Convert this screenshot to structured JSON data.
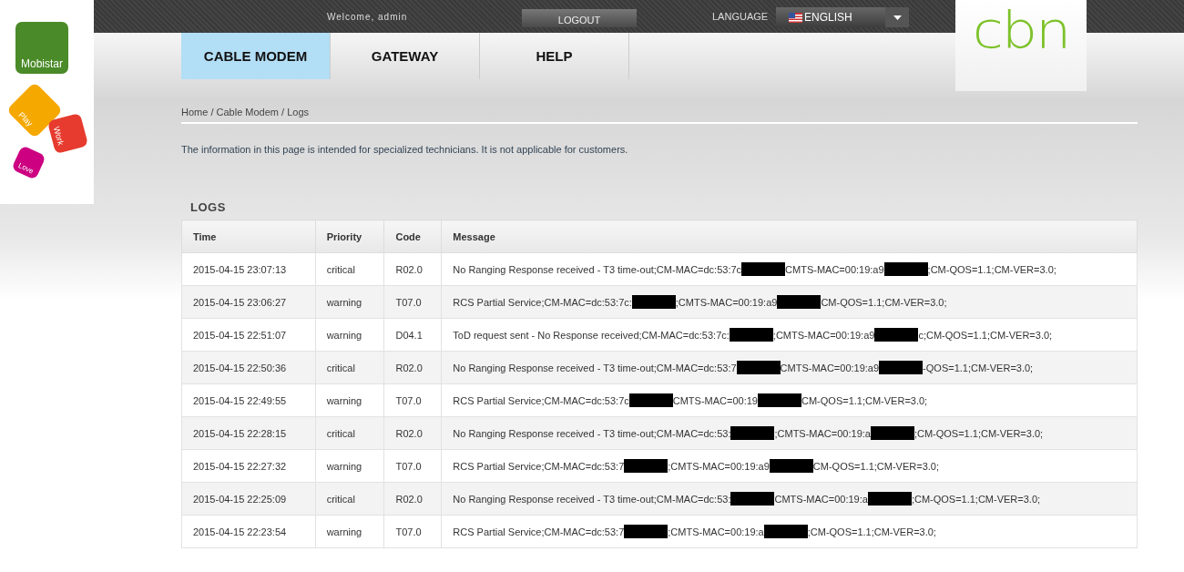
{
  "brand": {
    "name": "Mobistar",
    "tiles": [
      "Play",
      "Work",
      "Love"
    ],
    "logo": "cbn"
  },
  "top_bar": {
    "welcome": "Welcome, admin",
    "logout": "LOGOUT",
    "language_label": "LANGUAGE",
    "language": "ENGLISH"
  },
  "tabs": [
    {
      "label": "CABLE MODEM",
      "selected": true
    },
    {
      "label": "GATEWAY",
      "selected": false
    },
    {
      "label": "HELP",
      "selected": false
    }
  ],
  "breadcrumb": "Home / Cable Modem / Logs",
  "notice": "The information in this page is intended for specialized technicians. It is not applicable for customers.",
  "logs": {
    "title": "LOGS",
    "columns": [
      "Time",
      "Priority",
      "Code",
      "Message"
    ],
    "rows": [
      {
        "time": "2015-04-15 23:07:13",
        "priority": "critical",
        "code": "R02.0",
        "message": [
          {
            "kind": "text",
            "text": "No Ranging Response received - T3 time-out;CM-MAC=dc:53:7c"
          },
          {
            "kind": "redacted"
          },
          {
            "kind": "text",
            "text": "CMTS-MAC=00:19:a9"
          },
          {
            "kind": "redacted"
          },
          {
            "kind": "text",
            "text": ";CM-QOS=1.1;CM-VER=3.0;"
          }
        ]
      },
      {
        "time": "2015-04-15 23:06:27",
        "priority": "warning",
        "code": "T07.0",
        "message": [
          {
            "kind": "text",
            "text": "RCS Partial Service;CM-MAC=dc:53:7c:"
          },
          {
            "kind": "redacted"
          },
          {
            "kind": "text",
            "text": ";CMTS-MAC=00:19:a9"
          },
          {
            "kind": "redacted"
          },
          {
            "kind": "text",
            "text": "CM-QOS=1.1;CM-VER=3.0;"
          }
        ]
      },
      {
        "time": "2015-04-15 22:51:07",
        "priority": "warning",
        "code": "D04.1",
        "message": [
          {
            "kind": "text",
            "text": "ToD request sent - No Response received;CM-MAC=dc:53:7c:"
          },
          {
            "kind": "redacted"
          },
          {
            "kind": "text",
            "text": ";CMTS-MAC=00:19:a9"
          },
          {
            "kind": "redacted"
          },
          {
            "kind": "text",
            "text": "c;CM-QOS=1.1;CM-VER=3.0;"
          }
        ]
      },
      {
        "time": "2015-04-15 22:50:36",
        "priority": "critical",
        "code": "R02.0",
        "message": [
          {
            "kind": "text",
            "text": "No Ranging Response received - T3 time-out;CM-MAC=dc:53:7"
          },
          {
            "kind": "redacted"
          },
          {
            "kind": "text",
            "text": "CMTS-MAC=00:19:a9"
          },
          {
            "kind": "redacted"
          },
          {
            "kind": "text",
            "text": "-QOS=1.1;CM-VER=3.0;"
          }
        ]
      },
      {
        "time": "2015-04-15 22:49:55",
        "priority": "warning",
        "code": "T07.0",
        "message": [
          {
            "kind": "text",
            "text": "RCS Partial Service;CM-MAC=dc:53:7c"
          },
          {
            "kind": "redacted"
          },
          {
            "kind": "text",
            "text": "CMTS-MAC=00:19"
          },
          {
            "kind": "redacted"
          },
          {
            "kind": "text",
            "text": "CM-QOS=1.1;CM-VER=3.0;"
          }
        ]
      },
      {
        "time": "2015-04-15 22:28:15",
        "priority": "critical",
        "code": "R02.0",
        "message": [
          {
            "kind": "text",
            "text": "No Ranging Response received - T3 time-out;CM-MAC=dc:53:"
          },
          {
            "kind": "redacted"
          },
          {
            "kind": "text",
            "text": ";CMTS-MAC=00:19:a"
          },
          {
            "kind": "redacted"
          },
          {
            "kind": "text",
            "text": ";CM-QOS=1.1;CM-VER=3.0;"
          }
        ]
      },
      {
        "time": "2015-04-15 22:27:32",
        "priority": "warning",
        "code": "T07.0",
        "message": [
          {
            "kind": "text",
            "text": "RCS Partial Service;CM-MAC=dc:53:7"
          },
          {
            "kind": "redacted"
          },
          {
            "kind": "text",
            "text": ";CMTS-MAC=00:19:a9"
          },
          {
            "kind": "redacted"
          },
          {
            "kind": "text",
            "text": "CM-QOS=1.1;CM-VER=3.0;"
          }
        ]
      },
      {
        "time": "2015-04-15 22:25:09",
        "priority": "critical",
        "code": "R02.0",
        "message": [
          {
            "kind": "text",
            "text": "No Ranging Response received - T3 time-out;CM-MAC=dc:53:"
          },
          {
            "kind": "redacted"
          },
          {
            "kind": "text",
            "text": "CMTS-MAC=00:19:a"
          },
          {
            "kind": "redacted"
          },
          {
            "kind": "text",
            "text": ";CM-QOS=1.1;CM-VER=3.0;"
          }
        ]
      },
      {
        "time": "2015-04-15 22:23:54",
        "priority": "warning",
        "code": "T07.0",
        "message": [
          {
            "kind": "text",
            "text": "RCS Partial Service;CM-MAC=dc:53:7"
          },
          {
            "kind": "redacted"
          },
          {
            "kind": "text",
            "text": ";CMTS-MAC=00:19:a"
          },
          {
            "kind": "redacted"
          },
          {
            "kind": "text",
            "text": ";CM-QOS=1.1;CM-VER=3.0;"
          }
        ]
      }
    ]
  }
}
